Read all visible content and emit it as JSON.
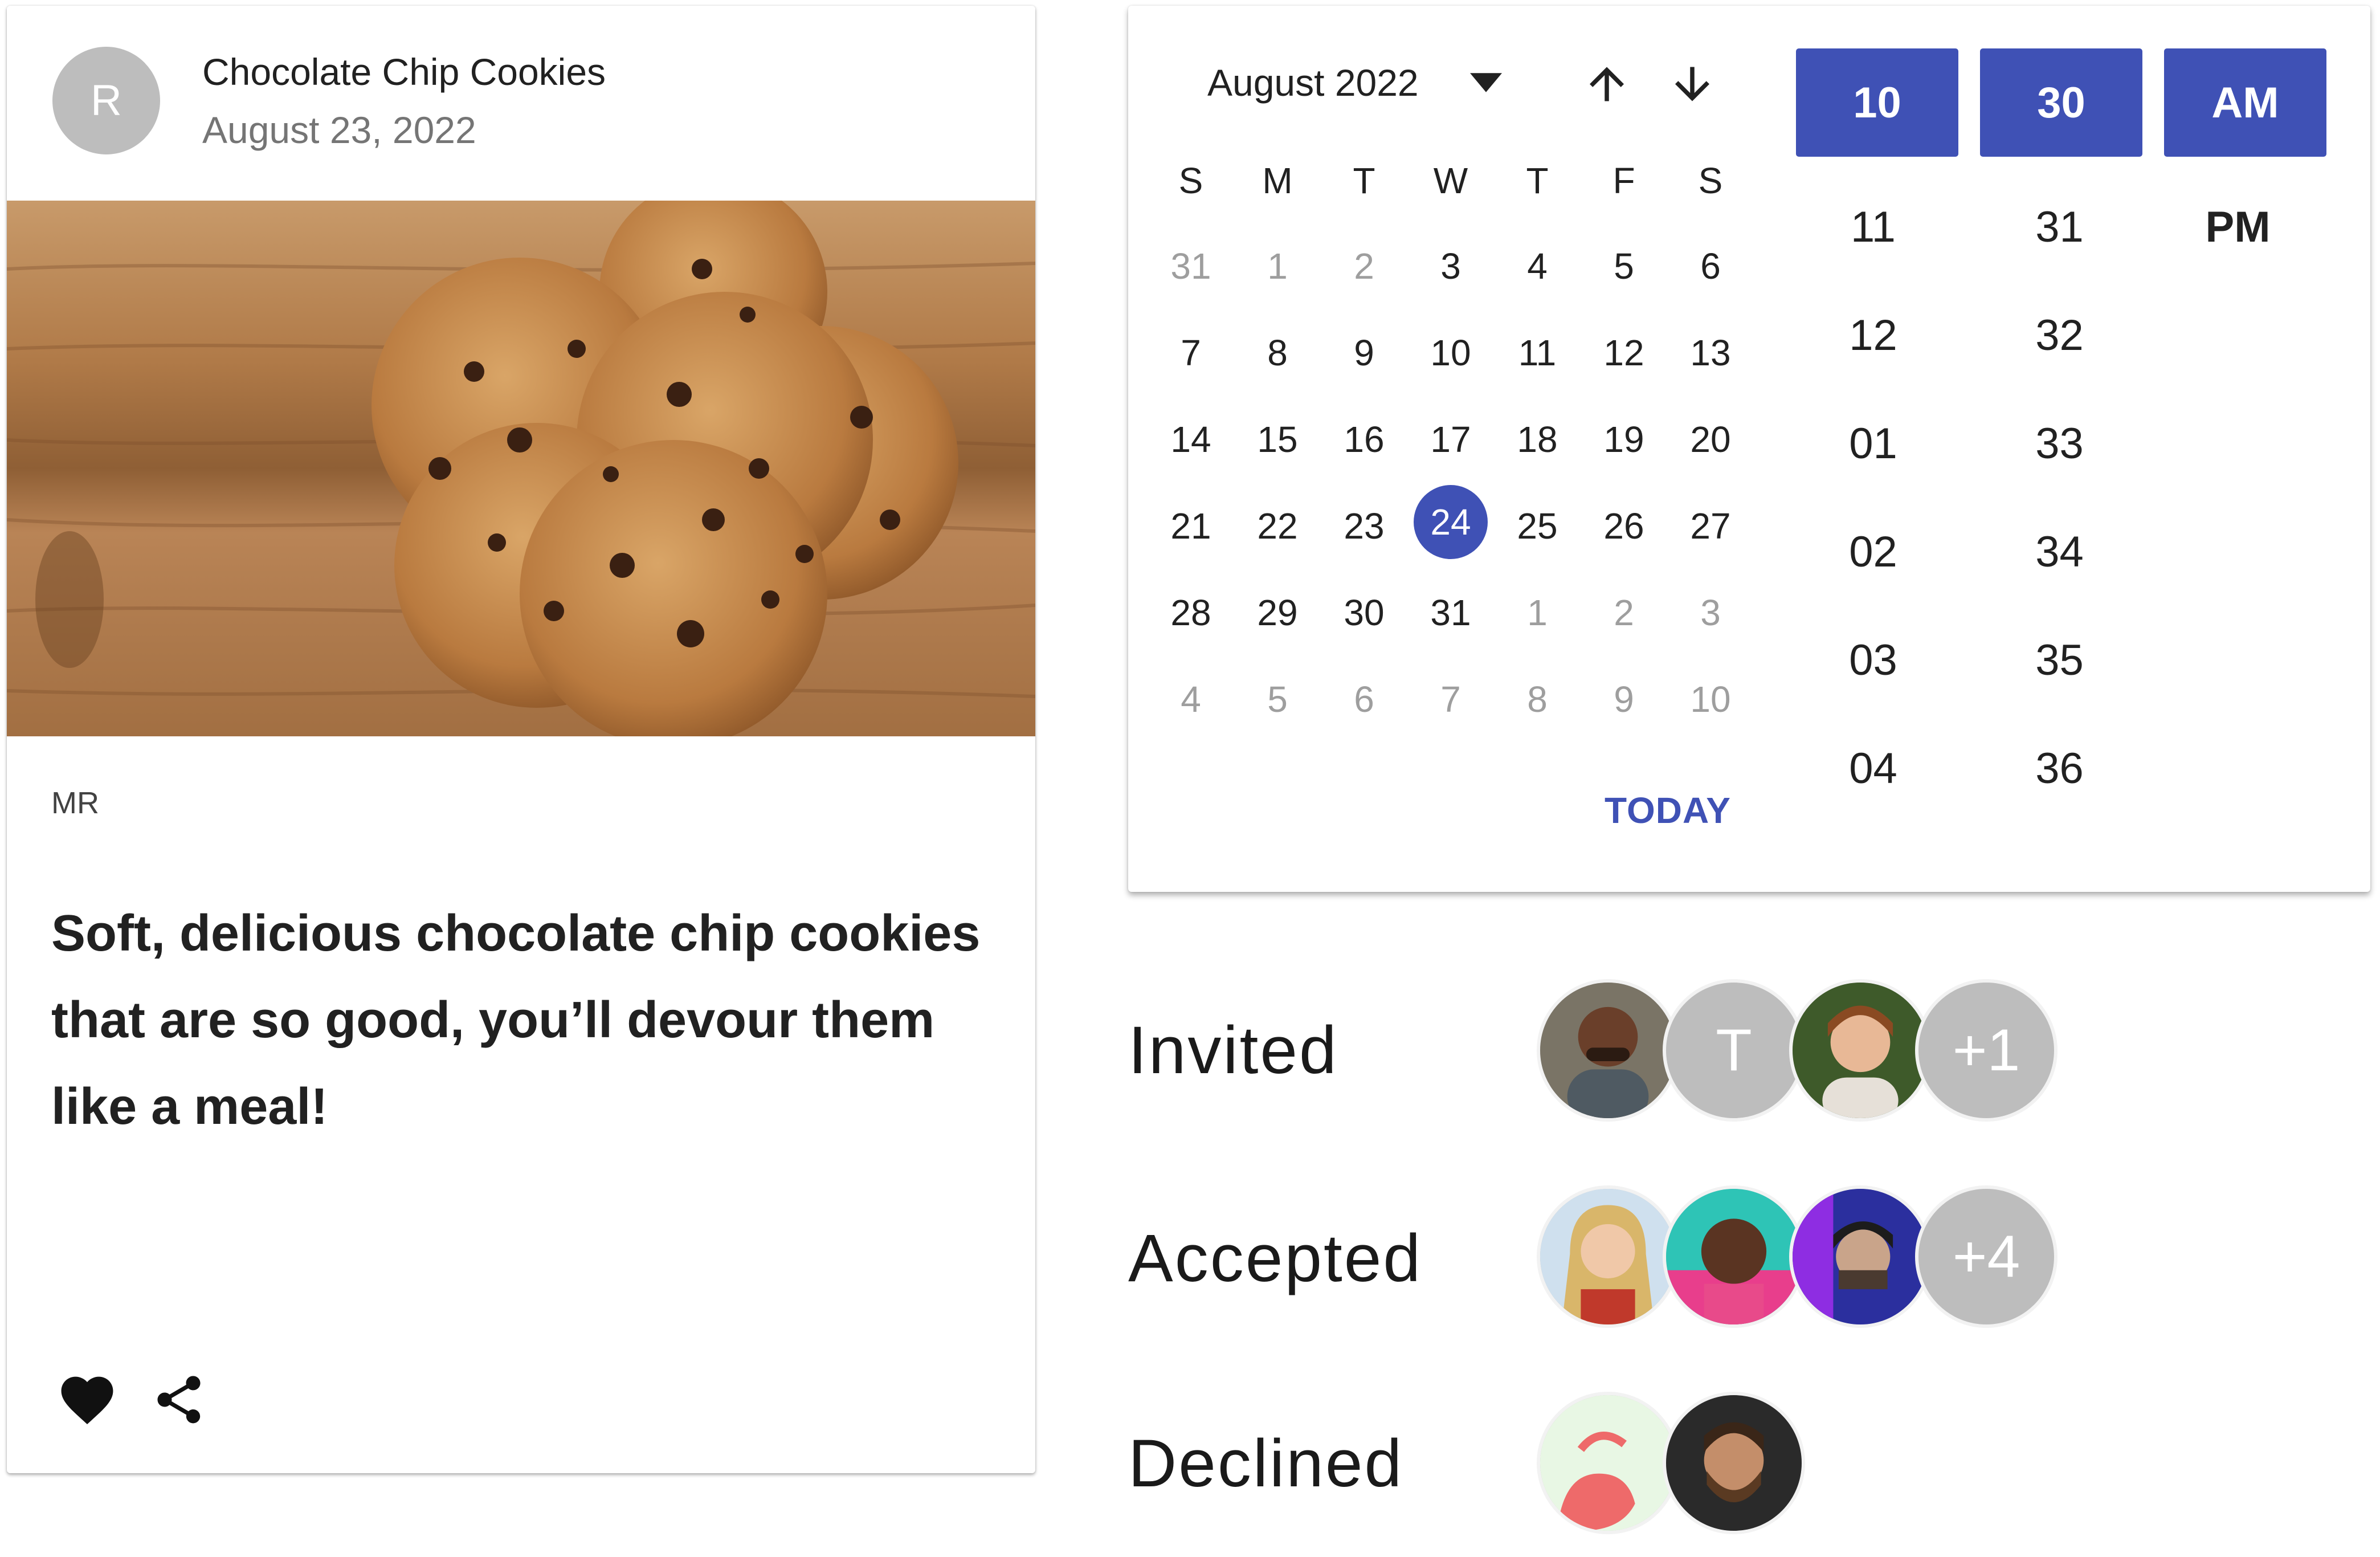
{
  "card": {
    "avatar_letter": "R",
    "title": "Chocolate Chip Cookies",
    "date": "August 23, 2022",
    "initials": "MR",
    "description": "Soft, delicious chocolate chip cookies that are so good, you’ll devour them like a meal!",
    "icons": [
      "heart-icon",
      "share-icon"
    ]
  },
  "calendar": {
    "month_label": "August 2022",
    "weekdays": [
      "S",
      "M",
      "T",
      "W",
      "T",
      "F",
      "S"
    ],
    "weeks": [
      [
        {
          "d": "31",
          "m": true
        },
        {
          "d": "1",
          "m": true
        },
        {
          "d": "2",
          "m": true
        },
        {
          "d": "3"
        },
        {
          "d": "4"
        },
        {
          "d": "5"
        },
        {
          "d": "6"
        }
      ],
      [
        {
          "d": "7"
        },
        {
          "d": "8"
        },
        {
          "d": "9"
        },
        {
          "d": "10"
        },
        {
          "d": "11"
        },
        {
          "d": "12"
        },
        {
          "d": "13"
        }
      ],
      [
        {
          "d": "14"
        },
        {
          "d": "15"
        },
        {
          "d": "16"
        },
        {
          "d": "17"
        },
        {
          "d": "18"
        },
        {
          "d": "19"
        },
        {
          "d": "20"
        }
      ],
      [
        {
          "d": "21"
        },
        {
          "d": "22"
        },
        {
          "d": "23"
        },
        {
          "d": "24",
          "s": true
        },
        {
          "d": "25"
        },
        {
          "d": "26"
        },
        {
          "d": "27"
        }
      ],
      [
        {
          "d": "28"
        },
        {
          "d": "29"
        },
        {
          "d": "30"
        },
        {
          "d": "31"
        },
        {
          "d": "1",
          "m": true
        },
        {
          "d": "2",
          "m": true
        },
        {
          "d": "3",
          "m": true
        }
      ],
      [
        {
          "d": "4",
          "m": true
        },
        {
          "d": "5",
          "m": true
        },
        {
          "d": "6",
          "m": true
        },
        {
          "d": "7",
          "m": true
        },
        {
          "d": "8",
          "m": true
        },
        {
          "d": "9",
          "m": true
        },
        {
          "d": "10",
          "m": true
        }
      ]
    ],
    "selected_day": "24",
    "today_label": "TODAY",
    "accent_color": "#3f51b5"
  },
  "time": {
    "selected": {
      "hour": "10",
      "minute": "30",
      "period": "AM"
    },
    "hours": [
      "11",
      "12",
      "01",
      "02",
      "03",
      "04"
    ],
    "minutes": [
      "31",
      "32",
      "33",
      "34",
      "35",
      "36"
    ],
    "periods": [
      "PM"
    ]
  },
  "groups": {
    "invited": {
      "label": "Invited",
      "letter": "T",
      "extra": "+1"
    },
    "accepted": {
      "label": "Accepted",
      "extra": "+4"
    },
    "declined": {
      "label": "Declined"
    }
  }
}
